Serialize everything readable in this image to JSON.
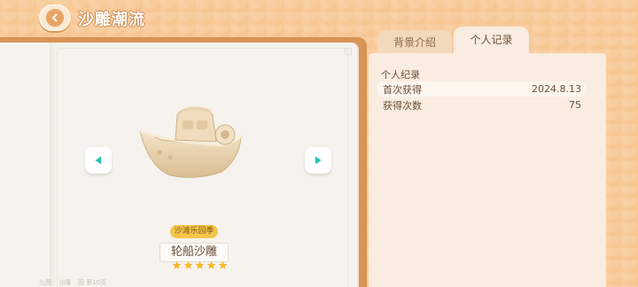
{
  "header": {
    "title": "沙雕潮流"
  },
  "item": {
    "season": "沙滩乐园季",
    "name": "轮船沙雕",
    "stars": 5
  },
  "footer": [
    "九图",
    "沙雕",
    "图 第10页"
  ],
  "tabs": [
    {
      "label": "背景介绍",
      "active": false
    },
    {
      "label": "个人记录",
      "active": true
    }
  ],
  "record": {
    "heading": "个人纪录",
    "rows": [
      {
        "label": "首次获得",
        "value": "2024.8.13"
      },
      {
        "label": "获得次数",
        "value": "75"
      }
    ]
  },
  "colors": {
    "background": "#f7c793",
    "panel": "#f9ece0",
    "arrow": "#2bbfb6",
    "badge": "#f5c64a",
    "star": "#f6b92a"
  }
}
